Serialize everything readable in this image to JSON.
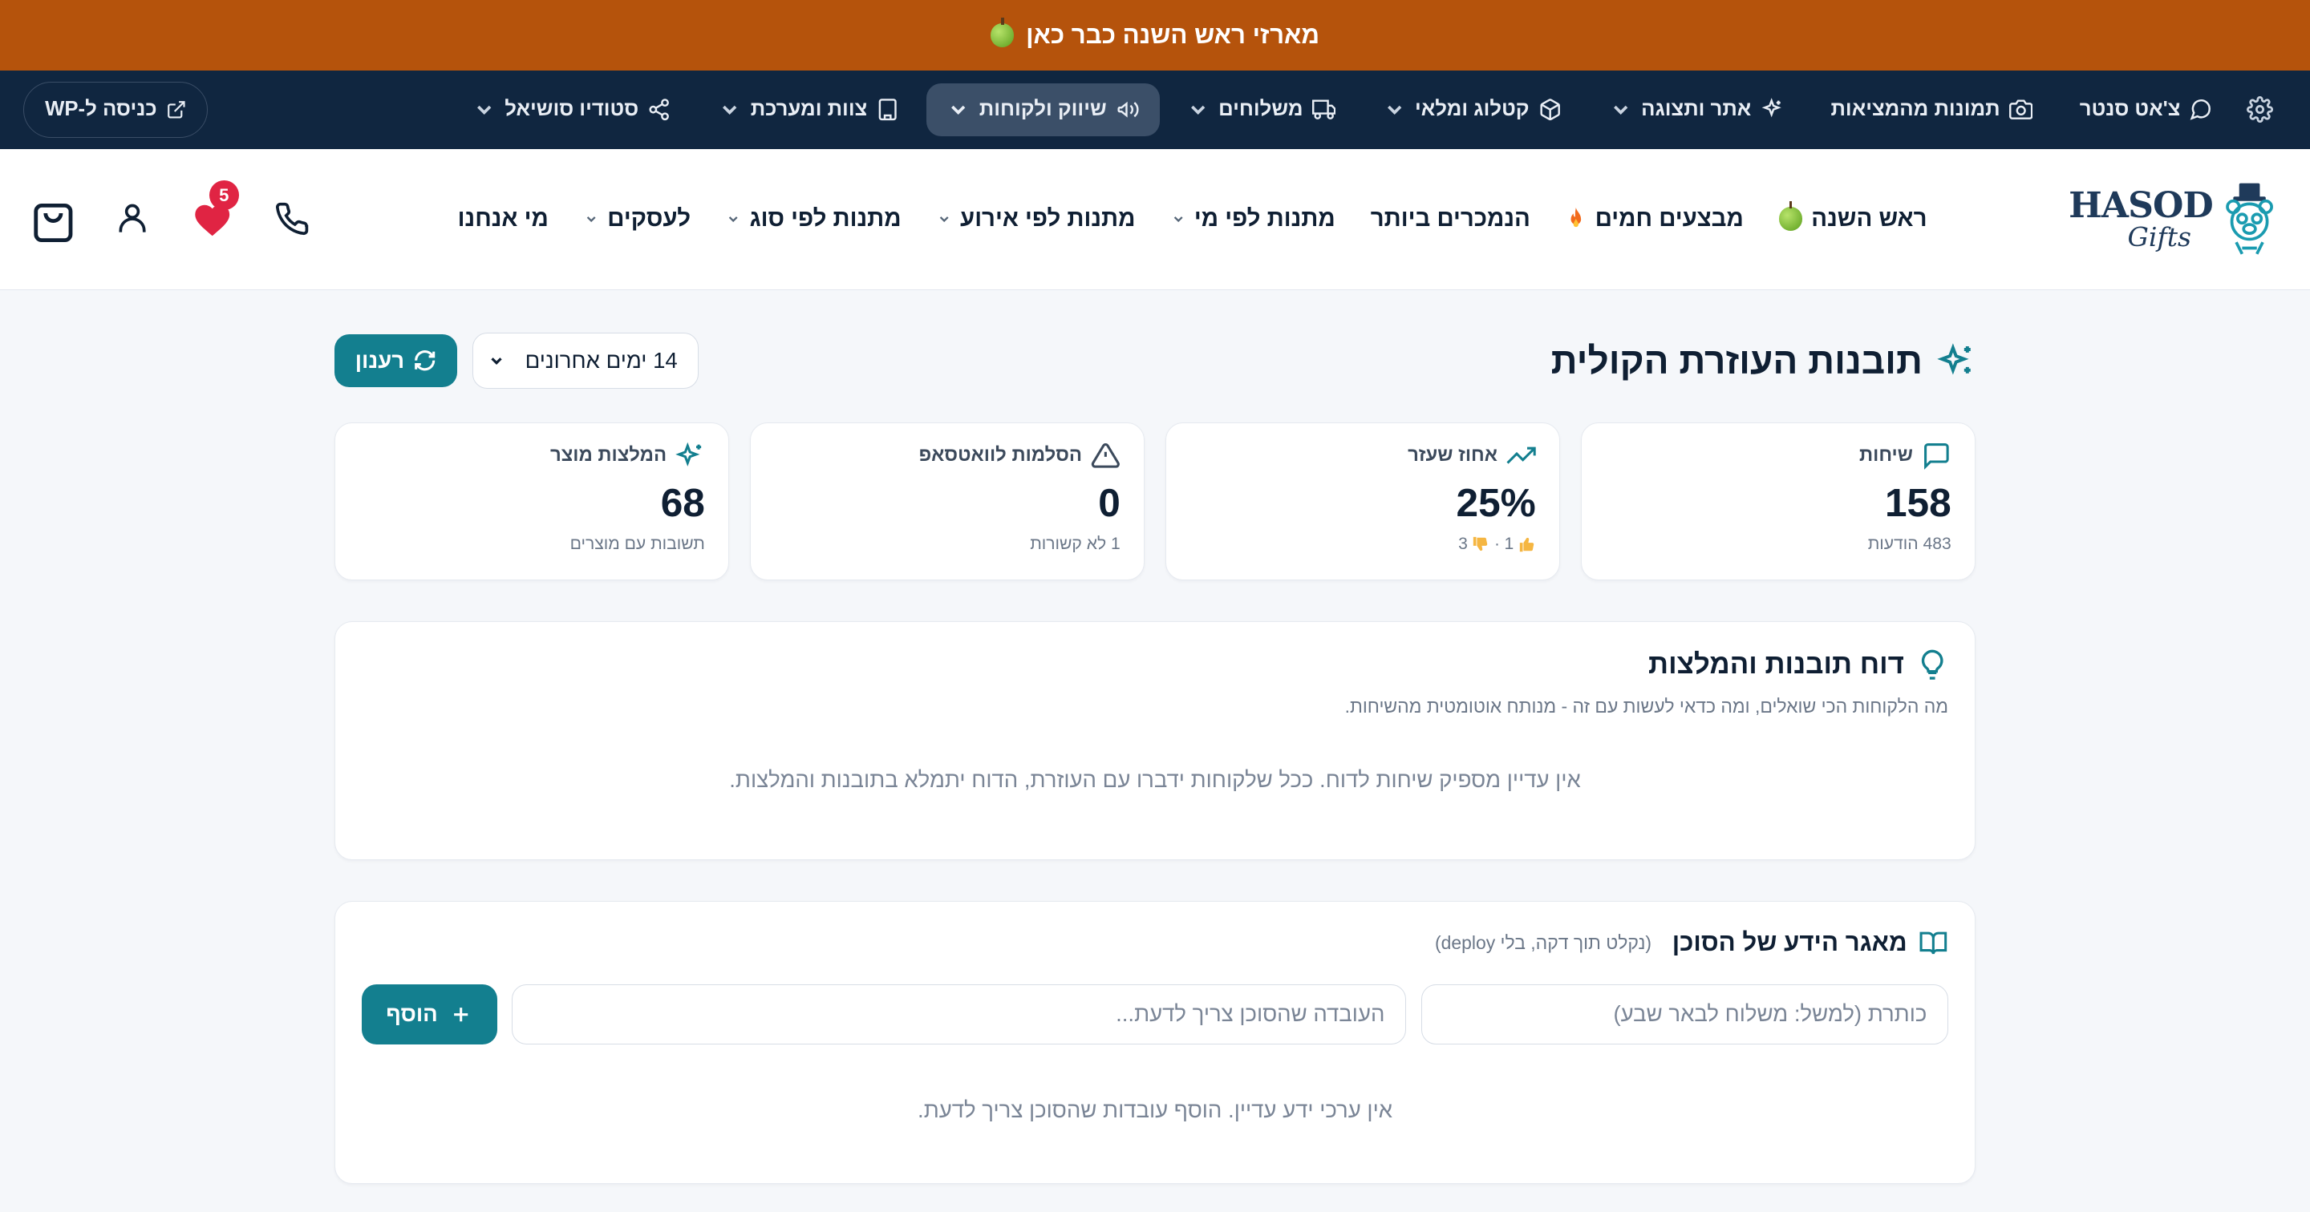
{
  "promo": {
    "text": "מארזי ראש השנה כבר כאן"
  },
  "admin_nav": {
    "items": [
      {
        "label": "צ'אט סנטר",
        "has_chevron": false
      },
      {
        "label": "תמונות מהמציאות",
        "has_chevron": false
      },
      {
        "label": "אתר ותצוגה",
        "has_chevron": true
      },
      {
        "label": "קטלוג ומלאי",
        "has_chevron": true
      },
      {
        "label": "משלוחים",
        "has_chevron": true
      },
      {
        "label": "שיווק ולקוחות",
        "has_chevron": true,
        "active": true
      },
      {
        "label": "צוות ומערכת",
        "has_chevron": true
      },
      {
        "label": "סטודיו סושיאל",
        "has_chevron": true
      }
    ],
    "wp_label": "כניסה ל-WP"
  },
  "store": {
    "logo_main": "HASOD",
    "logo_sub": "Gifts",
    "nav": [
      {
        "label": "ראש השנה",
        "has_chevron": false
      },
      {
        "label": "מבצעים חמים",
        "has_chevron": false
      },
      {
        "label": "הנמכרים ביותר",
        "has_chevron": false
      },
      {
        "label": "מתנות לפי מי",
        "has_chevron": true
      },
      {
        "label": "מתנות לפי אירוע",
        "has_chevron": true
      },
      {
        "label": "מתנות לפי סוג",
        "has_chevron": true
      },
      {
        "label": "לעסקים",
        "has_chevron": true
      },
      {
        "label": "מי אנחנו",
        "has_chevron": false
      }
    ],
    "wishlist_count": "5"
  },
  "page": {
    "title": "תובנות העוזרת הקולית",
    "range_value": "14 ימים אחרונים",
    "refresh_label": "רענון"
  },
  "stats": [
    {
      "label": "שיחות",
      "value": "158",
      "sub": "483 הודעות"
    },
    {
      "label": "אחוז שעזר",
      "value": "25%",
      "sub_up": "1",
      "sub_sep": "·",
      "sub_down": "3"
    },
    {
      "label": "הסלמות לוואטסאפ",
      "value": "0",
      "sub": "1 לא קשורות"
    },
    {
      "label": "המלצות מוצר",
      "value": "68",
      "sub": "תשובות עם מוצרים"
    }
  ],
  "insights": {
    "title": "דוח תובנות והמלצות",
    "subtitle": "מה הלקוחות הכי שואלים, ומה כדאי לעשות עם זה - מנותח אוטומטית מהשיחות.",
    "empty": "אין עדיין מספיק שיחות לדוח. ככל שלקוחות ידברו עם העוזרת, הדוח יתמלא בתובנות והמלצות."
  },
  "knowledge": {
    "title": "מאגר הידע של הסוכן",
    "hint": "(נקלט תוך דקה, בלי deploy)",
    "title_placeholder": "כותרת (למשל: משלוח לבאר שבע)",
    "fact_placeholder": "העובדה שהסוכן צריך לדעת...",
    "add_label": "הוסף",
    "empty": "אין ערכי ידע עדיין. הוסף עובדות שהסוכן צריך לדעת."
  },
  "colors": {
    "promo": "#b5530c",
    "admin_bg": "#102640",
    "accent": "#137f8f",
    "badge": "#e02443"
  }
}
